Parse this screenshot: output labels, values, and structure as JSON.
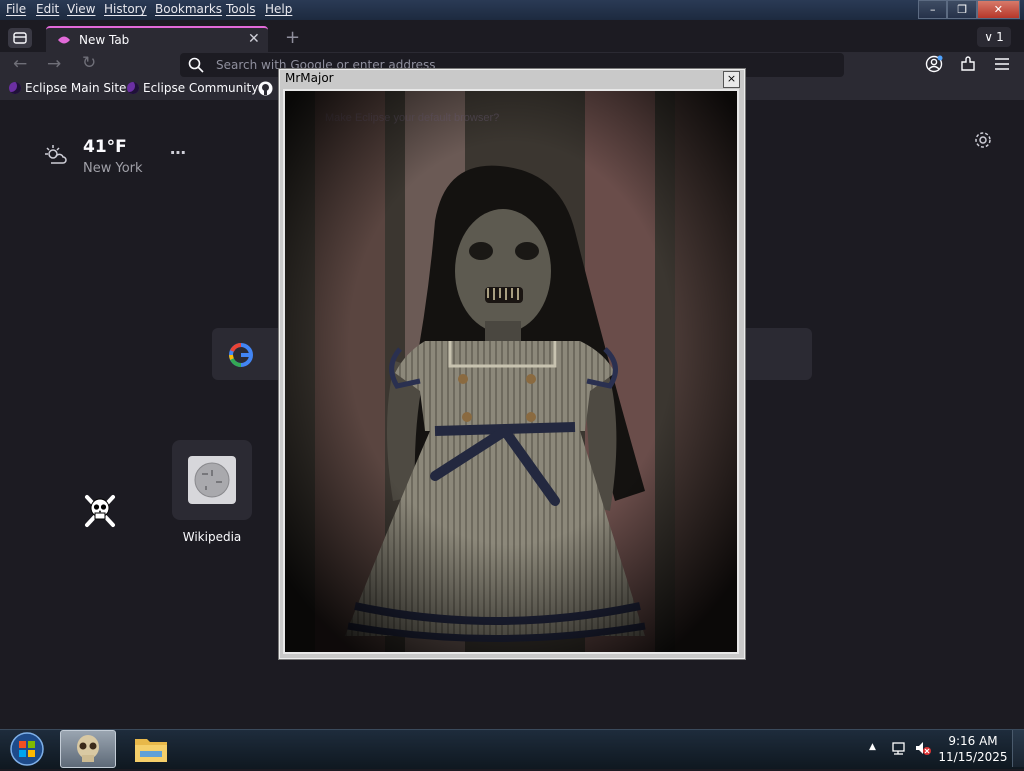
{
  "menu": [
    "File",
    "Edit",
    "View",
    "History",
    "Bookmarks",
    "Tools",
    "Help"
  ],
  "window_controls": {
    "minimize": "–",
    "maximize": "❐",
    "close": "✕",
    "tab_count": "1"
  },
  "tab": {
    "title": "New Tab"
  },
  "urlbar": {
    "placeholder": "Search with Google or enter address"
  },
  "bookmarks": [
    "Eclipse Main Site",
    "Eclipse Community"
  ],
  "weather": {
    "temp": "41°F",
    "city": "New York"
  },
  "shortcut": {
    "label": "Wikipedia"
  },
  "popup": {
    "title": "MrMajor",
    "close": "×"
  },
  "taskbar": {
    "time": "9:16 AM",
    "date": "11/15/2025"
  },
  "icons": [
    "firefox-view-icon",
    "tab-icon",
    "close-tab-icon",
    "new-tab-icon",
    "back-icon",
    "forward-icon",
    "reload-icon",
    "search-icon",
    "account-icon",
    "extensions-icon",
    "menu-icon",
    "github-icon",
    "weather-icon",
    "more-icon",
    "settings-icon",
    "google-icon",
    "wikipedia-icon",
    "skull-crossbones-icon",
    "windows-start-icon",
    "skull-app-icon",
    "file-explorer-icon",
    "tray-arrow-icon",
    "network-icon",
    "volume-muted-icon"
  ],
  "colors": {
    "accent": "#e26ad9",
    "background": "#1c1b22",
    "toolbar": "#2b2a33"
  }
}
